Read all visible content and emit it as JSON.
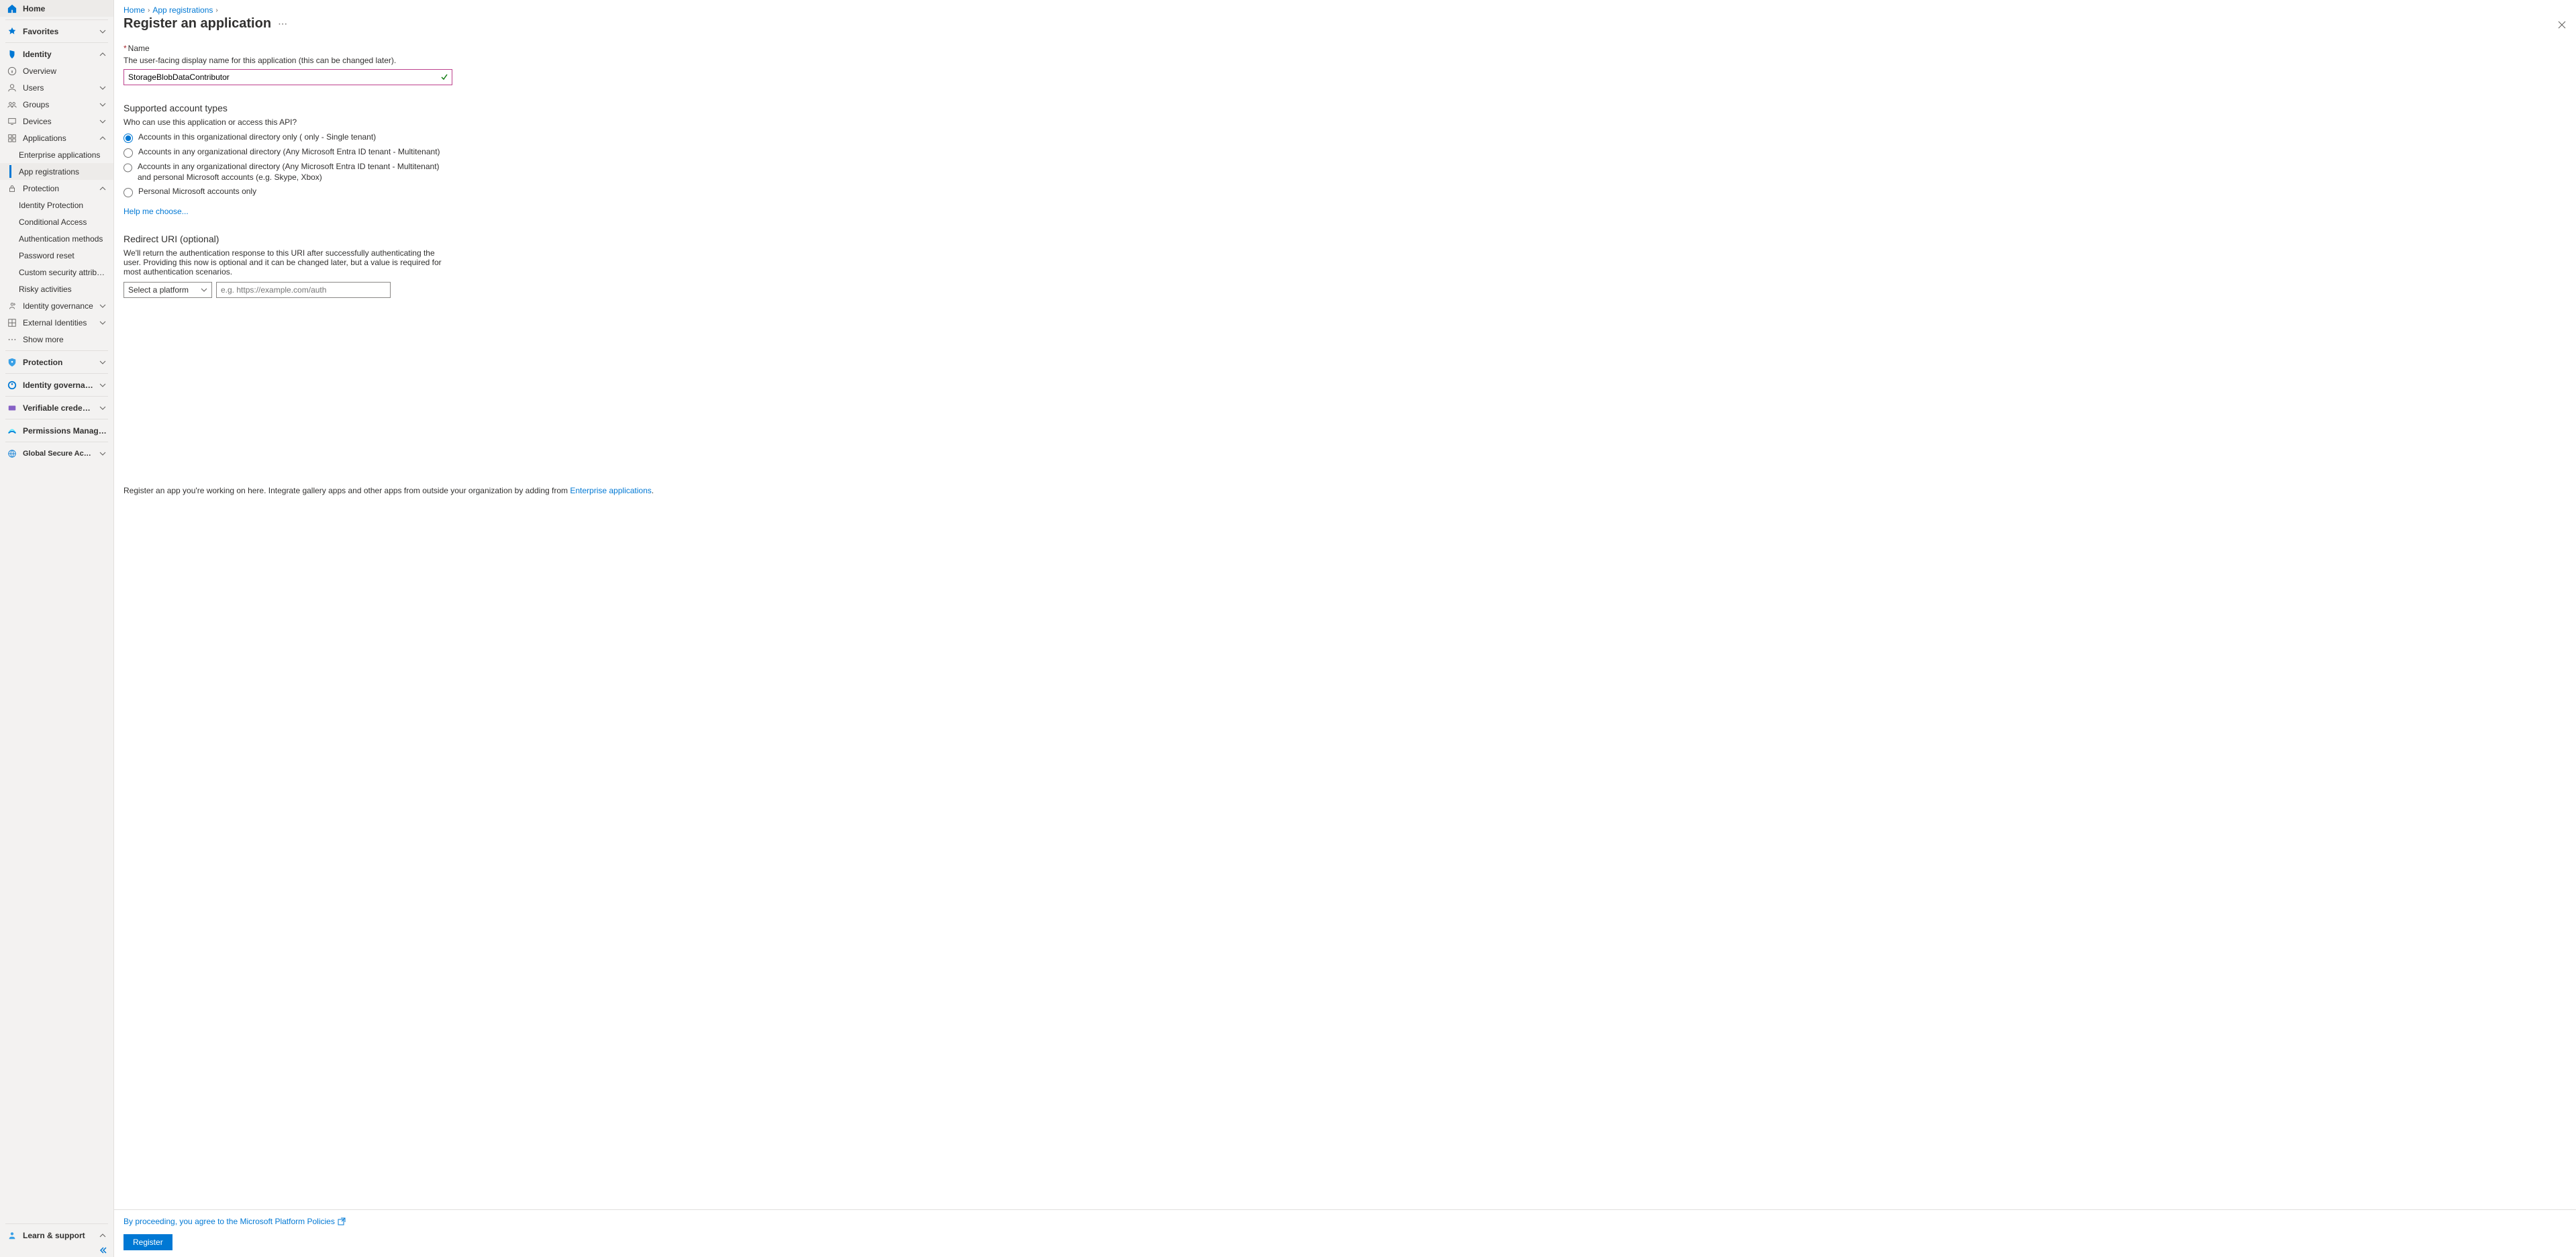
{
  "sidebar": {
    "home": "Home",
    "favorites": "Favorites",
    "identity": {
      "label": "Identity",
      "overview": "Overview",
      "users": "Users",
      "groups": "Groups",
      "devices": "Devices",
      "applications": {
        "label": "Applications",
        "enterprise": "Enterprise applications",
        "registrations": "App registrations"
      },
      "protection": {
        "label": "Protection",
        "identity_protection": "Identity Protection",
        "conditional_access": "Conditional Access",
        "auth_methods": "Authentication methods",
        "password_reset": "Password reset",
        "custom_sec": "Custom security attributes",
        "risky": "Risky activities"
      },
      "governance": "Identity governance",
      "external": "External Identities",
      "show_more": "Show more"
    },
    "protection": "Protection",
    "identity_governance": "Identity governance",
    "verifiable": "Verifiable credentials",
    "permissions": "Permissions Management",
    "gsa": "Global Secure Access (Preview)",
    "learn": "Learn & support"
  },
  "breadcrumbs": {
    "home": "Home",
    "app_reg": "App registrations"
  },
  "page": {
    "title": "Register an application",
    "more": "⋯"
  },
  "name_section": {
    "label": "Name",
    "desc": "The user-facing display name for this application (this can be changed later).",
    "value": "StorageBlobDataContributor"
  },
  "account_types": {
    "heading": "Supported account types",
    "sub": "Who can use this application or access this API?",
    "options": [
      "Accounts in this organizational directory only (                     only - Single tenant)",
      "Accounts in any organizational directory (Any Microsoft Entra ID tenant - Multitenant)",
      "Accounts in any organizational directory (Any Microsoft Entra ID tenant - Multitenant) and personal Microsoft accounts (e.g. Skype, Xbox)",
      "Personal Microsoft accounts only"
    ],
    "help": "Help me choose..."
  },
  "redirect": {
    "heading": "Redirect URI (optional)",
    "desc": "We'll return the authentication response to this URI after successfully authenticating the user. Providing this now is optional and it can be changed later, but a value is required for most authentication scenarios.",
    "platform_placeholder": "Select a platform",
    "uri_placeholder": "e.g. https://example.com/auth"
  },
  "bottom": {
    "note_prefix": "Register an app you're working on here. Integrate gallery apps and other apps from outside your organization by adding from ",
    "note_link": "Enterprise applications",
    "note_suffix": "."
  },
  "footer": {
    "policies": "By proceeding, you agree to the Microsoft Platform Policies",
    "register": "Register"
  }
}
